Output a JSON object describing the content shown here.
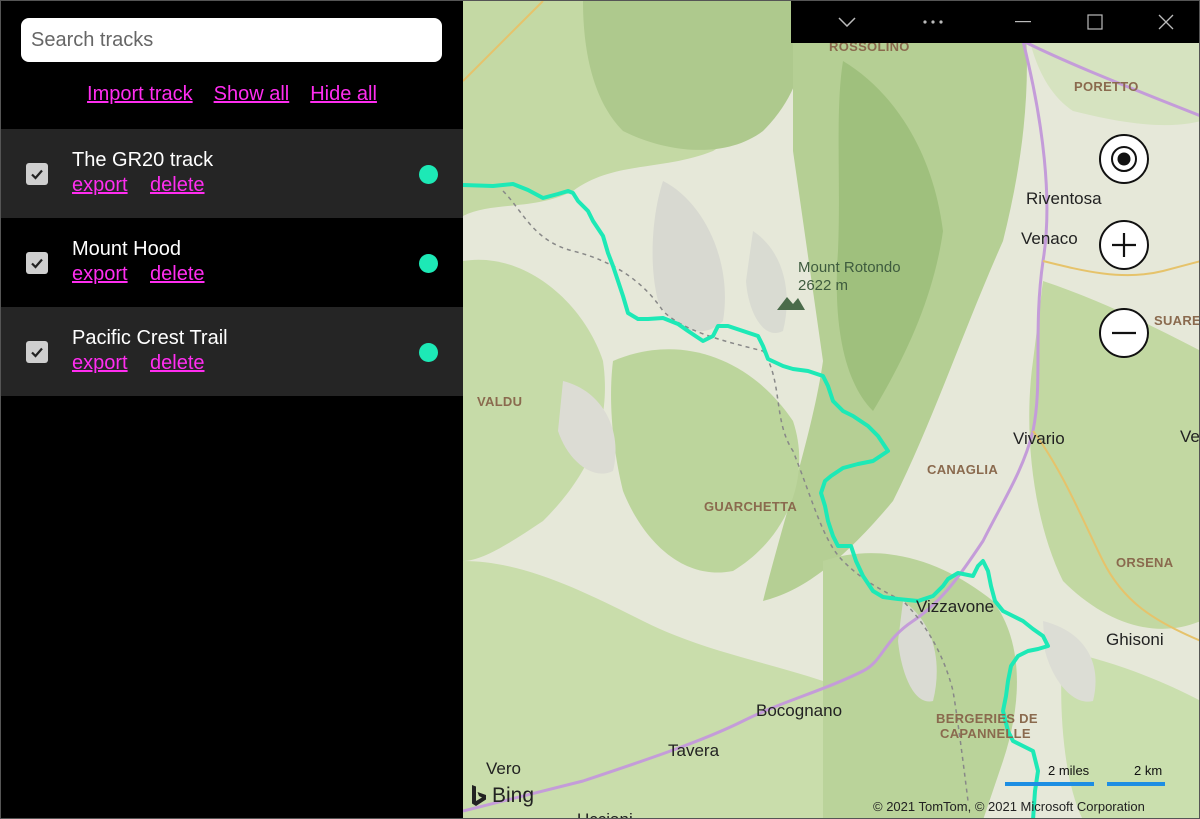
{
  "sidebar": {
    "search": {
      "placeholder": "Search tracks",
      "value": ""
    },
    "actions": {
      "import": "Import track",
      "show_all": "Show all",
      "hide_all": "Hide all"
    },
    "tracks": [
      {
        "name": "The GR20 track",
        "checked": true,
        "export": "export",
        "delete": "delete",
        "color": "#1de9b6"
      },
      {
        "name": "Mount Hood",
        "checked": true,
        "export": "export",
        "delete": "delete",
        "color": "#1de9b6"
      },
      {
        "name": "Pacific Crest Trail",
        "checked": true,
        "export": "export",
        "delete": "delete",
        "color": "#1de9b6"
      }
    ]
  },
  "map": {
    "places": {
      "riventosa": "Riventosa",
      "venaco": "Venaco",
      "vivario": "Vivario",
      "ve": "Ve",
      "vizzavone": "Vizzavone",
      "ghisoni": "Ghisoni",
      "bocognano": "Bocognano",
      "tavera": "Tavera",
      "vero": "Vero",
      "ucciani": "Ucciani"
    },
    "regions": {
      "rossolino": "ROSSOLINO",
      "poretto": "PORETTO",
      "suarella": "SUARELL",
      "valdu": "VALDU",
      "canaglia": "CANAGLIA",
      "guarchetta": "GUARCHETTA",
      "orsena": "ORSENA",
      "bergeries_1": "BERGERIES DE",
      "bergeries_2": "CAPANNELLE"
    },
    "peak": {
      "name": "Mount Rotondo",
      "elevation": "2622 m"
    },
    "scale": {
      "miles": "2 miles",
      "km": "2 km"
    },
    "attribution": "© 2021 TomTom, © 2021 Microsoft Corporation",
    "provider": "Bing",
    "track_color": "#1de9b6"
  }
}
